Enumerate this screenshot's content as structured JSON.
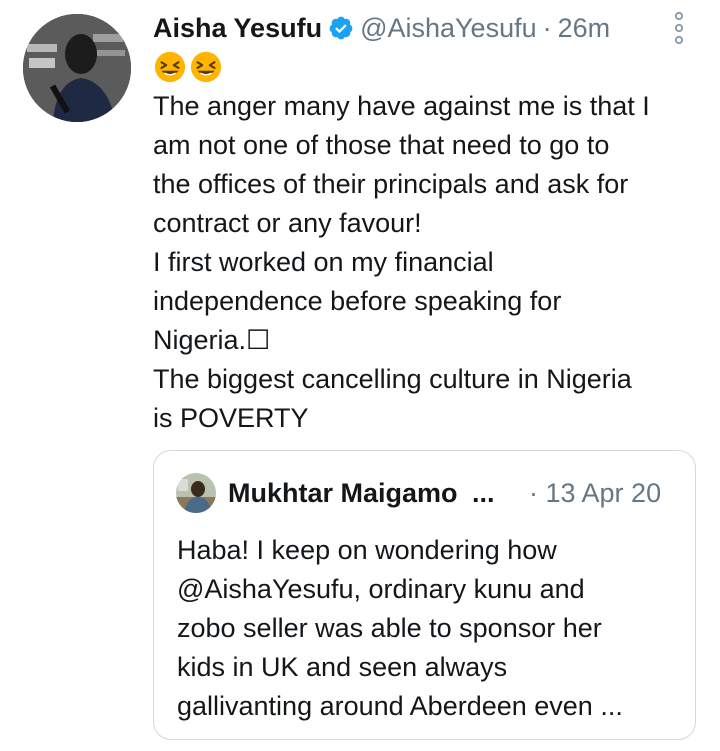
{
  "tweet": {
    "author_name": "Aisha Yesufu",
    "handle": "@AishaYesufu",
    "separator": "·",
    "time": "26m",
    "emojis": [
      "laughing-face",
      "laughing-face"
    ],
    "body_lines": [
      "The anger many have against me is that I",
      "am not one of those that need to go to",
      "the offices of their principals and ask for",
      "contract or any favour!",
      "I first worked on my financial",
      "independence before speaking for",
      "Nigeria.☐",
      "The biggest cancelling culture in Nigeria",
      "is POVERTY"
    ]
  },
  "quoted_tweet": {
    "author_name": "Mukhtar Maigamo",
    "truncation": "...",
    "time": "· 13 Apr 20",
    "body_lines": [
      "Haba! I keep on wondering how",
      "@AishaYesufu, ordinary kunu and",
      "zobo seller was able to sponsor her",
      "kids in UK and seen always",
      "gallivanting around Aberdeen even ..."
    ]
  },
  "colors": {
    "verified_blue": "#1da1f2",
    "secondary_text": "#657786",
    "primary_text": "#14171a",
    "border": "#cfd9de",
    "emoji_yellow": "#ffb400"
  }
}
